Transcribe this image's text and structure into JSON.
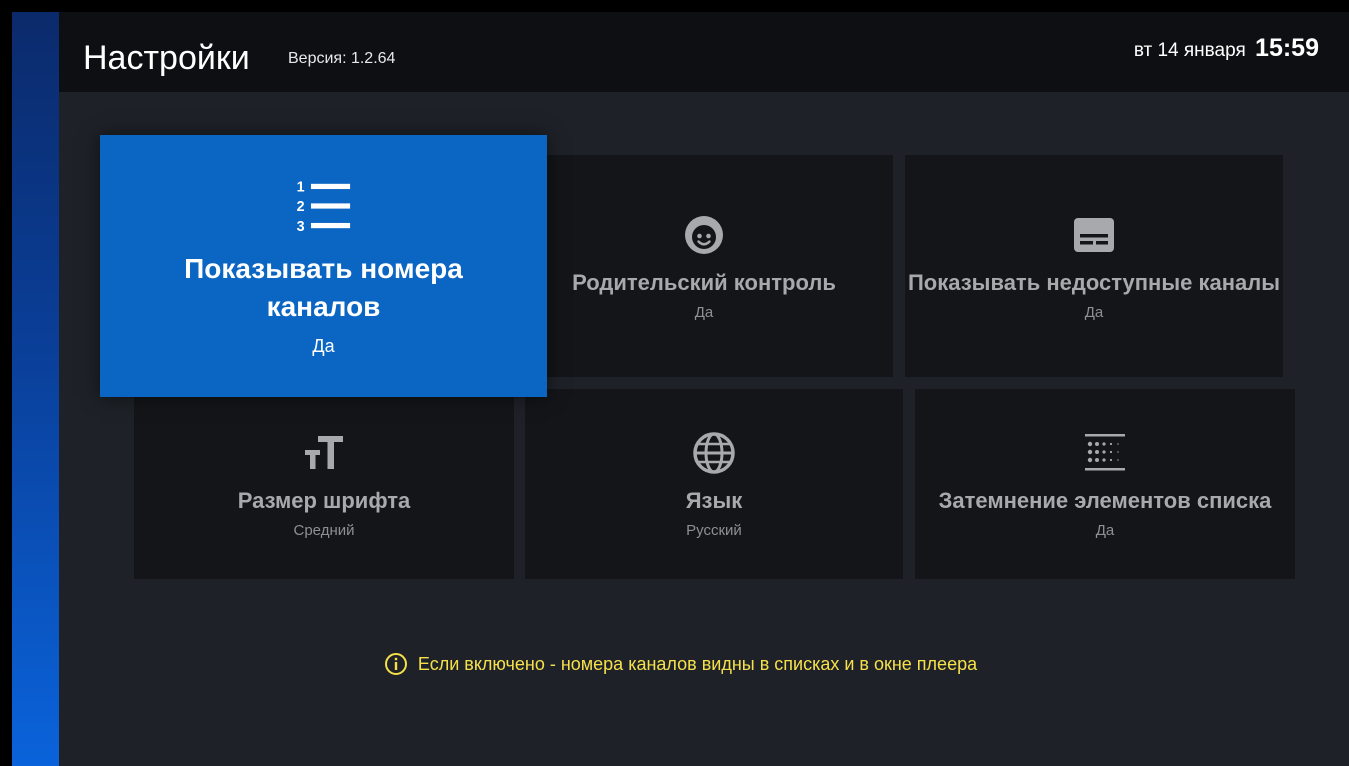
{
  "header": {
    "title": "Настройки",
    "version": "Версия: 1.2.64",
    "date": "вт 14 января",
    "time": "15:59"
  },
  "tiles": [
    {
      "icon": "format-list-numbered-icon",
      "label": "Показывать номера каналов",
      "value": "Да"
    },
    {
      "icon": "child-face-icon",
      "label": "Родительский контроль",
      "value": "Да"
    },
    {
      "icon": "subtitles-icon",
      "label": "Показывать недоступные каналы",
      "value": "Да"
    },
    {
      "icon": "format-size-icon",
      "label": "Размер шрифта",
      "value": "Средний"
    },
    {
      "icon": "globe-icon",
      "label": "Язык",
      "value": "Русский"
    },
    {
      "icon": "blur-dots-icon",
      "label": "Затемнение элементов списка",
      "value": "Да"
    }
  ],
  "hint": {
    "icon": "info-icon",
    "text": "Если включено - номера каналов видны в списках и в окне плеера"
  },
  "colors": {
    "accent": "#0a66c2",
    "hint_text": "#f5e04a",
    "background": "#1e2228",
    "tile_background": "#131518"
  }
}
